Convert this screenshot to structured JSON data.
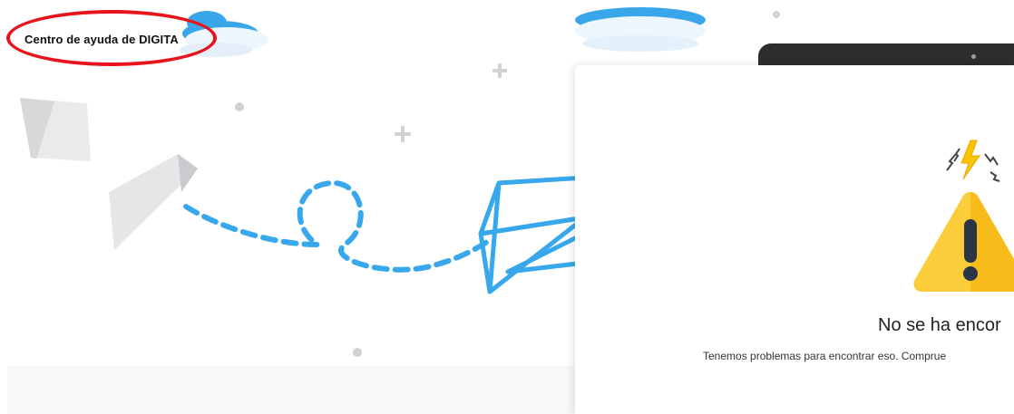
{
  "header": {
    "title": "Centro de ayuda de DIGITA"
  },
  "error": {
    "title": "No se ha encor",
    "message": "Tenemos problemas para encontrar eso. Comprue"
  },
  "icons": {
    "warning": "warning-triangle-icon",
    "plane": "paper-plane-icon"
  },
  "colors": {
    "accent_blue": "#37a8ec",
    "annotation_red": "#e8141b",
    "warning_yellow": "#f7b500"
  }
}
